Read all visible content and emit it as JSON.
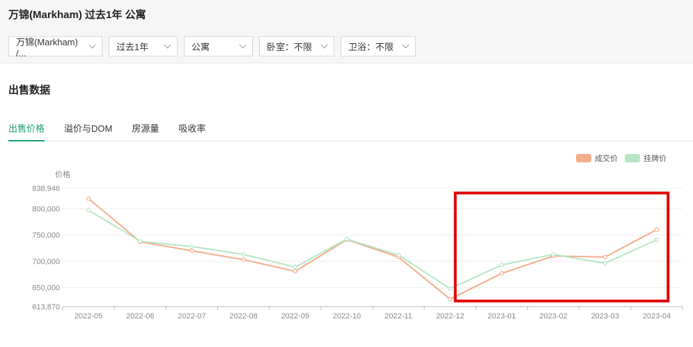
{
  "header": {
    "title": "万锦(Markham) 过去1年 公寓",
    "filters": [
      {
        "label": "万锦(Markham) /...",
        "icon": "chevron-down-icon"
      },
      {
        "label": "过去1年",
        "icon": "chevron-down-icon"
      },
      {
        "label": "公寓",
        "icon": "chevron-down-icon"
      },
      {
        "label": "卧室：不限",
        "icon": "chevron-down-icon"
      },
      {
        "label": "卫浴：不限",
        "icon": "chevron-down-icon"
      }
    ]
  },
  "section": {
    "title": "出售数据",
    "tabs": [
      {
        "label": "出售价格",
        "active": true
      },
      {
        "label": "溢价与DOM",
        "active": false
      },
      {
        "label": "房源量",
        "active": false
      },
      {
        "label": "吸收率",
        "active": false
      }
    ]
  },
  "colors": {
    "sold": "#f4ad8a",
    "listing": "#b6e6c6",
    "accent": "#1aa06b",
    "highlight": "#e10000"
  },
  "chart_data": {
    "type": "line",
    "ylabel": "价格",
    "ylim": [
      613870,
      838946
    ],
    "yticks": [
      "613,870",
      "650,000",
      "700,000",
      "750,000",
      "800,000",
      "838,946"
    ],
    "categories": [
      "2022-05",
      "2022-06",
      "2022-07",
      "2022-08",
      "2022-09",
      "2022-10",
      "2022-11",
      "2022-12",
      "2023-01",
      "2023-02",
      "2023-03",
      "2023-04"
    ],
    "legend_position": "top-right",
    "grid": true,
    "series": [
      {
        "name": "成交价",
        "color": "#f4ad8a",
        "values": [
          819000,
          737000,
          720000,
          703000,
          681000,
          741000,
          708000,
          628000,
          677000,
          710000,
          708000,
          760000
        ]
      },
      {
        "name": "挂牌价",
        "color": "#b6e6c6",
        "values": [
          797000,
          738000,
          728000,
          713000,
          689000,
          742000,
          712000,
          648000,
          693000,
          713000,
          696000,
          741000
        ]
      }
    ],
    "highlight_range": [
      "2022-12",
      "2023-04"
    ]
  }
}
